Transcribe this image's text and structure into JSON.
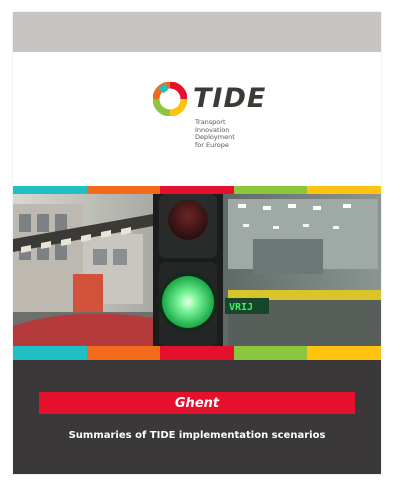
{
  "cover": {
    "logo": {
      "word": "TIDE",
      "tagline": [
        "Transport",
        "Innovation",
        "Deployment",
        "for Europe"
      ],
      "mark_icon": "tide-ring-logo-icon"
    },
    "city": "Ghent",
    "subtitle": "Summaries of TIDE implementation scenarios",
    "photo_sign": "VRIJ",
    "stripe_colors": [
      "#1fbfc4",
      "#f26a1b",
      "#e4102c",
      "#8cc63f",
      "#ffc20e"
    ],
    "colors": {
      "top_band": "#c8c4c1",
      "dark_area": "#3a3838",
      "city_band": "#e4102c",
      "traffic_light_green": "#39e36b"
    }
  }
}
